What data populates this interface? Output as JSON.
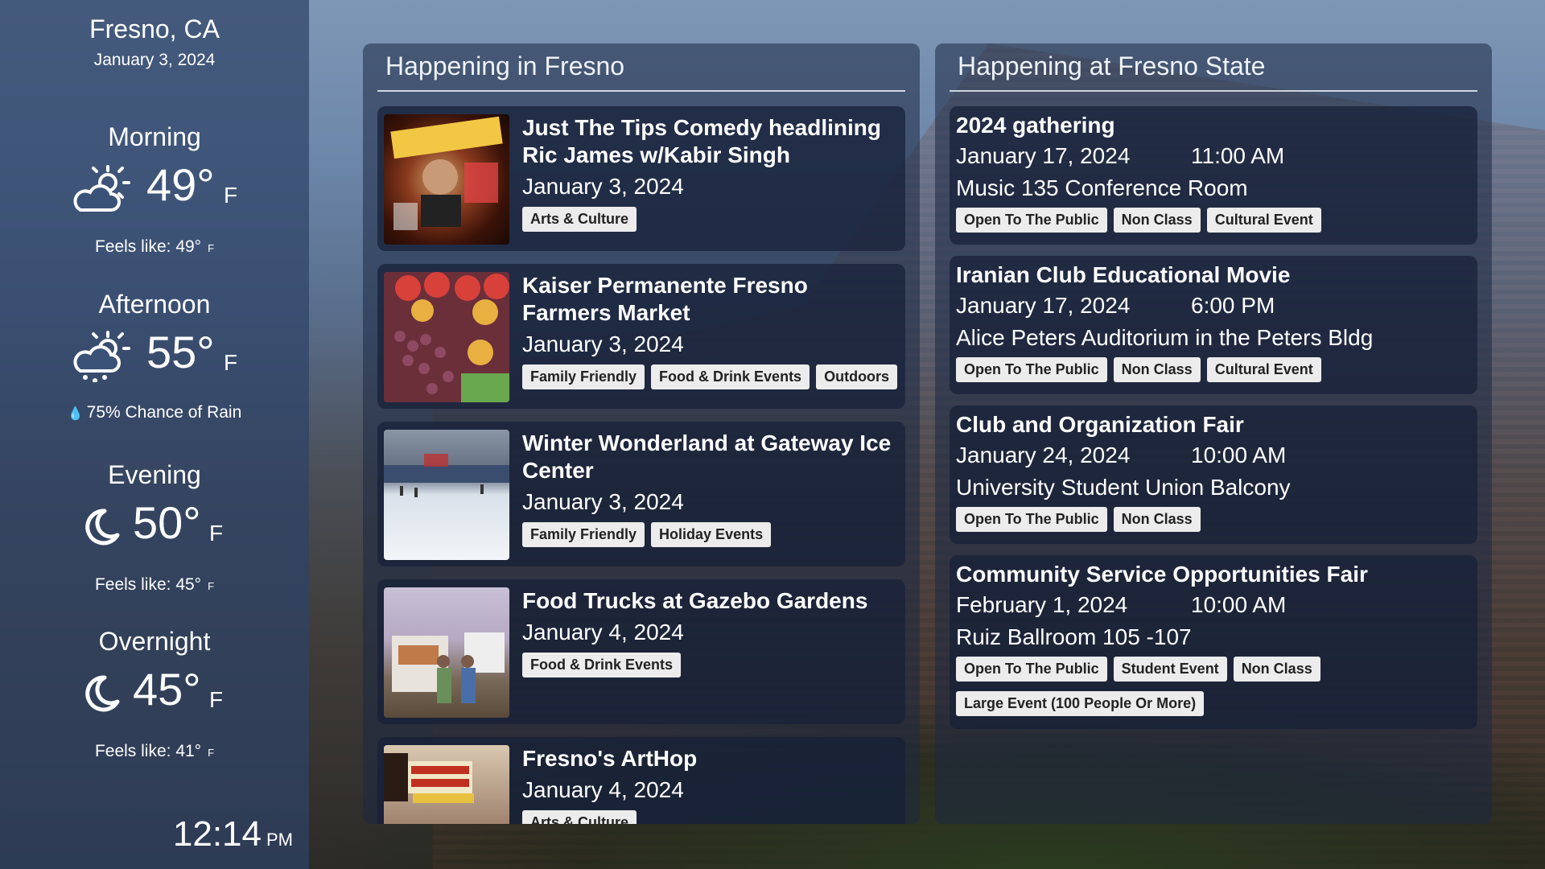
{
  "weather": {
    "city": "Fresno, CA",
    "date": "January 3, 2024",
    "periods": [
      {
        "name": "Morning",
        "temp": "49°",
        "unit": "F",
        "icon": "partly-cloudy-day-icon",
        "sub_label": "Feels like: 49°",
        "sub_unit": "F"
      },
      {
        "name": "Afternoon",
        "temp": "55°",
        "unit": "F",
        "icon": "rain-sun-icon",
        "sub_label": "75% Chance of Rain",
        "sub_unit": ""
      },
      {
        "name": "Evening",
        "temp": "50°",
        "unit": "F",
        "icon": "moon-icon",
        "sub_label": "Feels like: 45°",
        "sub_unit": "F"
      },
      {
        "name": "Overnight",
        "temp": "45°",
        "unit": "F",
        "icon": "moon-icon",
        "sub_label": "Feels like: 41°",
        "sub_unit": "F"
      }
    ],
    "clock": {
      "time": "12:14",
      "ampm": "PM"
    }
  },
  "fresno": {
    "title": "Happening in Fresno",
    "events": [
      {
        "title": "Just The Tips Comedy headlining Ric James w/Kabir Singh",
        "date": "January 3, 2024",
        "tags": [
          "Arts & Culture"
        ]
      },
      {
        "title": "Kaiser Permanente Fresno Farmers Market",
        "date": "January 3, 2024",
        "tags": [
          "Family Friendly",
          "Food & Drink Events",
          "Outdoors"
        ]
      },
      {
        "title": "Winter Wonderland at Gateway Ice Center",
        "date": "January 3, 2024",
        "tags": [
          "Family Friendly",
          "Holiday Events"
        ]
      },
      {
        "title": "Food Trucks at Gazebo Gardens",
        "date": "January 4, 2024",
        "tags": [
          "Food & Drink Events"
        ]
      },
      {
        "title": "Fresno's ArtHop",
        "date": "January 4, 2024",
        "tags": [
          "Arts & Culture"
        ]
      }
    ]
  },
  "state": {
    "title": "Happening at Fresno State",
    "events": [
      {
        "title": "2024 gathering",
        "date": "January 17, 2024",
        "time": "11:00 AM",
        "location": "Music 135 Conference Room",
        "tags": [
          "Open To The Public",
          "Non Class",
          "Cultural Event"
        ]
      },
      {
        "title": "Iranian Club Educational Movie",
        "date": "January 17, 2024",
        "time": "6:00 PM",
        "location": "Alice Peters Auditorium in the Peters Bldg",
        "tags": [
          "Open To The Public",
          "Non Class",
          "Cultural Event"
        ]
      },
      {
        "title": "Club and Organization Fair",
        "date": "January 24, 2024",
        "time": "10:00 AM",
        "location": "University Student Union Balcony",
        "tags": [
          "Open To The Public",
          "Non Class"
        ]
      },
      {
        "title": "Community Service Opportunities Fair",
        "date": "February 1, 2024",
        "time": "10:00 AM",
        "location": "Ruiz Ballroom 105 -107",
        "tags": [
          "Open To The Public",
          "Student Event",
          "Non Class",
          "Large Event (100 People Or More)"
        ]
      }
    ]
  },
  "colors": {
    "sidebar": "#2e4266",
    "panel": "#1c2842",
    "tag_bg": "#ececec",
    "tag_text": "#222222"
  }
}
